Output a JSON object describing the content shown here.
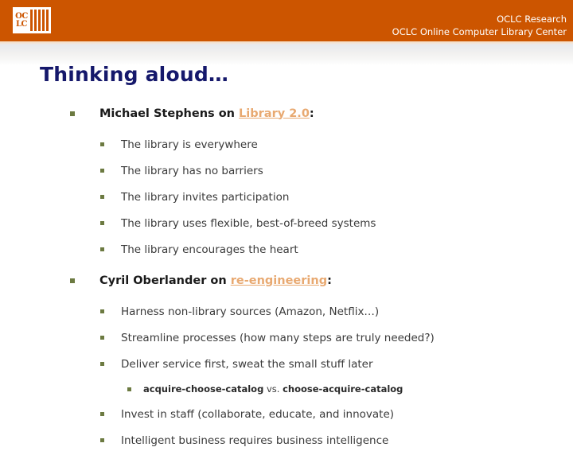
{
  "header": {
    "logo_letters_top": "OC",
    "logo_letters_bottom": "LC",
    "logo_name": "oclc-logo",
    "line1": "OCLC Research",
    "line2": "OCLC Online Computer Library Center",
    "band_color": "#cc5500"
  },
  "title": "Thinking aloud…",
  "colors": {
    "accent_orange": "#cc5500",
    "link_orange": "#e8a971",
    "title_navy": "#15186b",
    "bullet_green": "#6c7a41",
    "body_text": "#3a3a3a"
  },
  "sections": [
    {
      "heading_prefix": "Michael Stephens on ",
      "heading_link": "Library 2.0",
      "heading_suffix": ":",
      "items": [
        "The library is everywhere",
        "The library has no barriers",
        "The library invites participation",
        "The library uses flexible, best-of-breed systems",
        "The library encourages the heart"
      ]
    },
    {
      "heading_prefix": "Cyril Oberlander on ",
      "heading_link": "re-engineering",
      "heading_suffix": ":",
      "items": [
        "Harness non-library sources (Amazon, Netflix…)",
        "Streamline processes (how many steps are truly needed?)",
        "Deliver service first, sweat the small stuff later"
      ],
      "subitem": {
        "term_a": "acquire-choose-catalog",
        "connector": " vs. ",
        "term_b": "choose-acquire-catalog"
      },
      "items_after": [
        "Invest in staff (collaborate, educate, and innovate)",
        "Intelligent business requires business intelligence"
      ]
    }
  ]
}
